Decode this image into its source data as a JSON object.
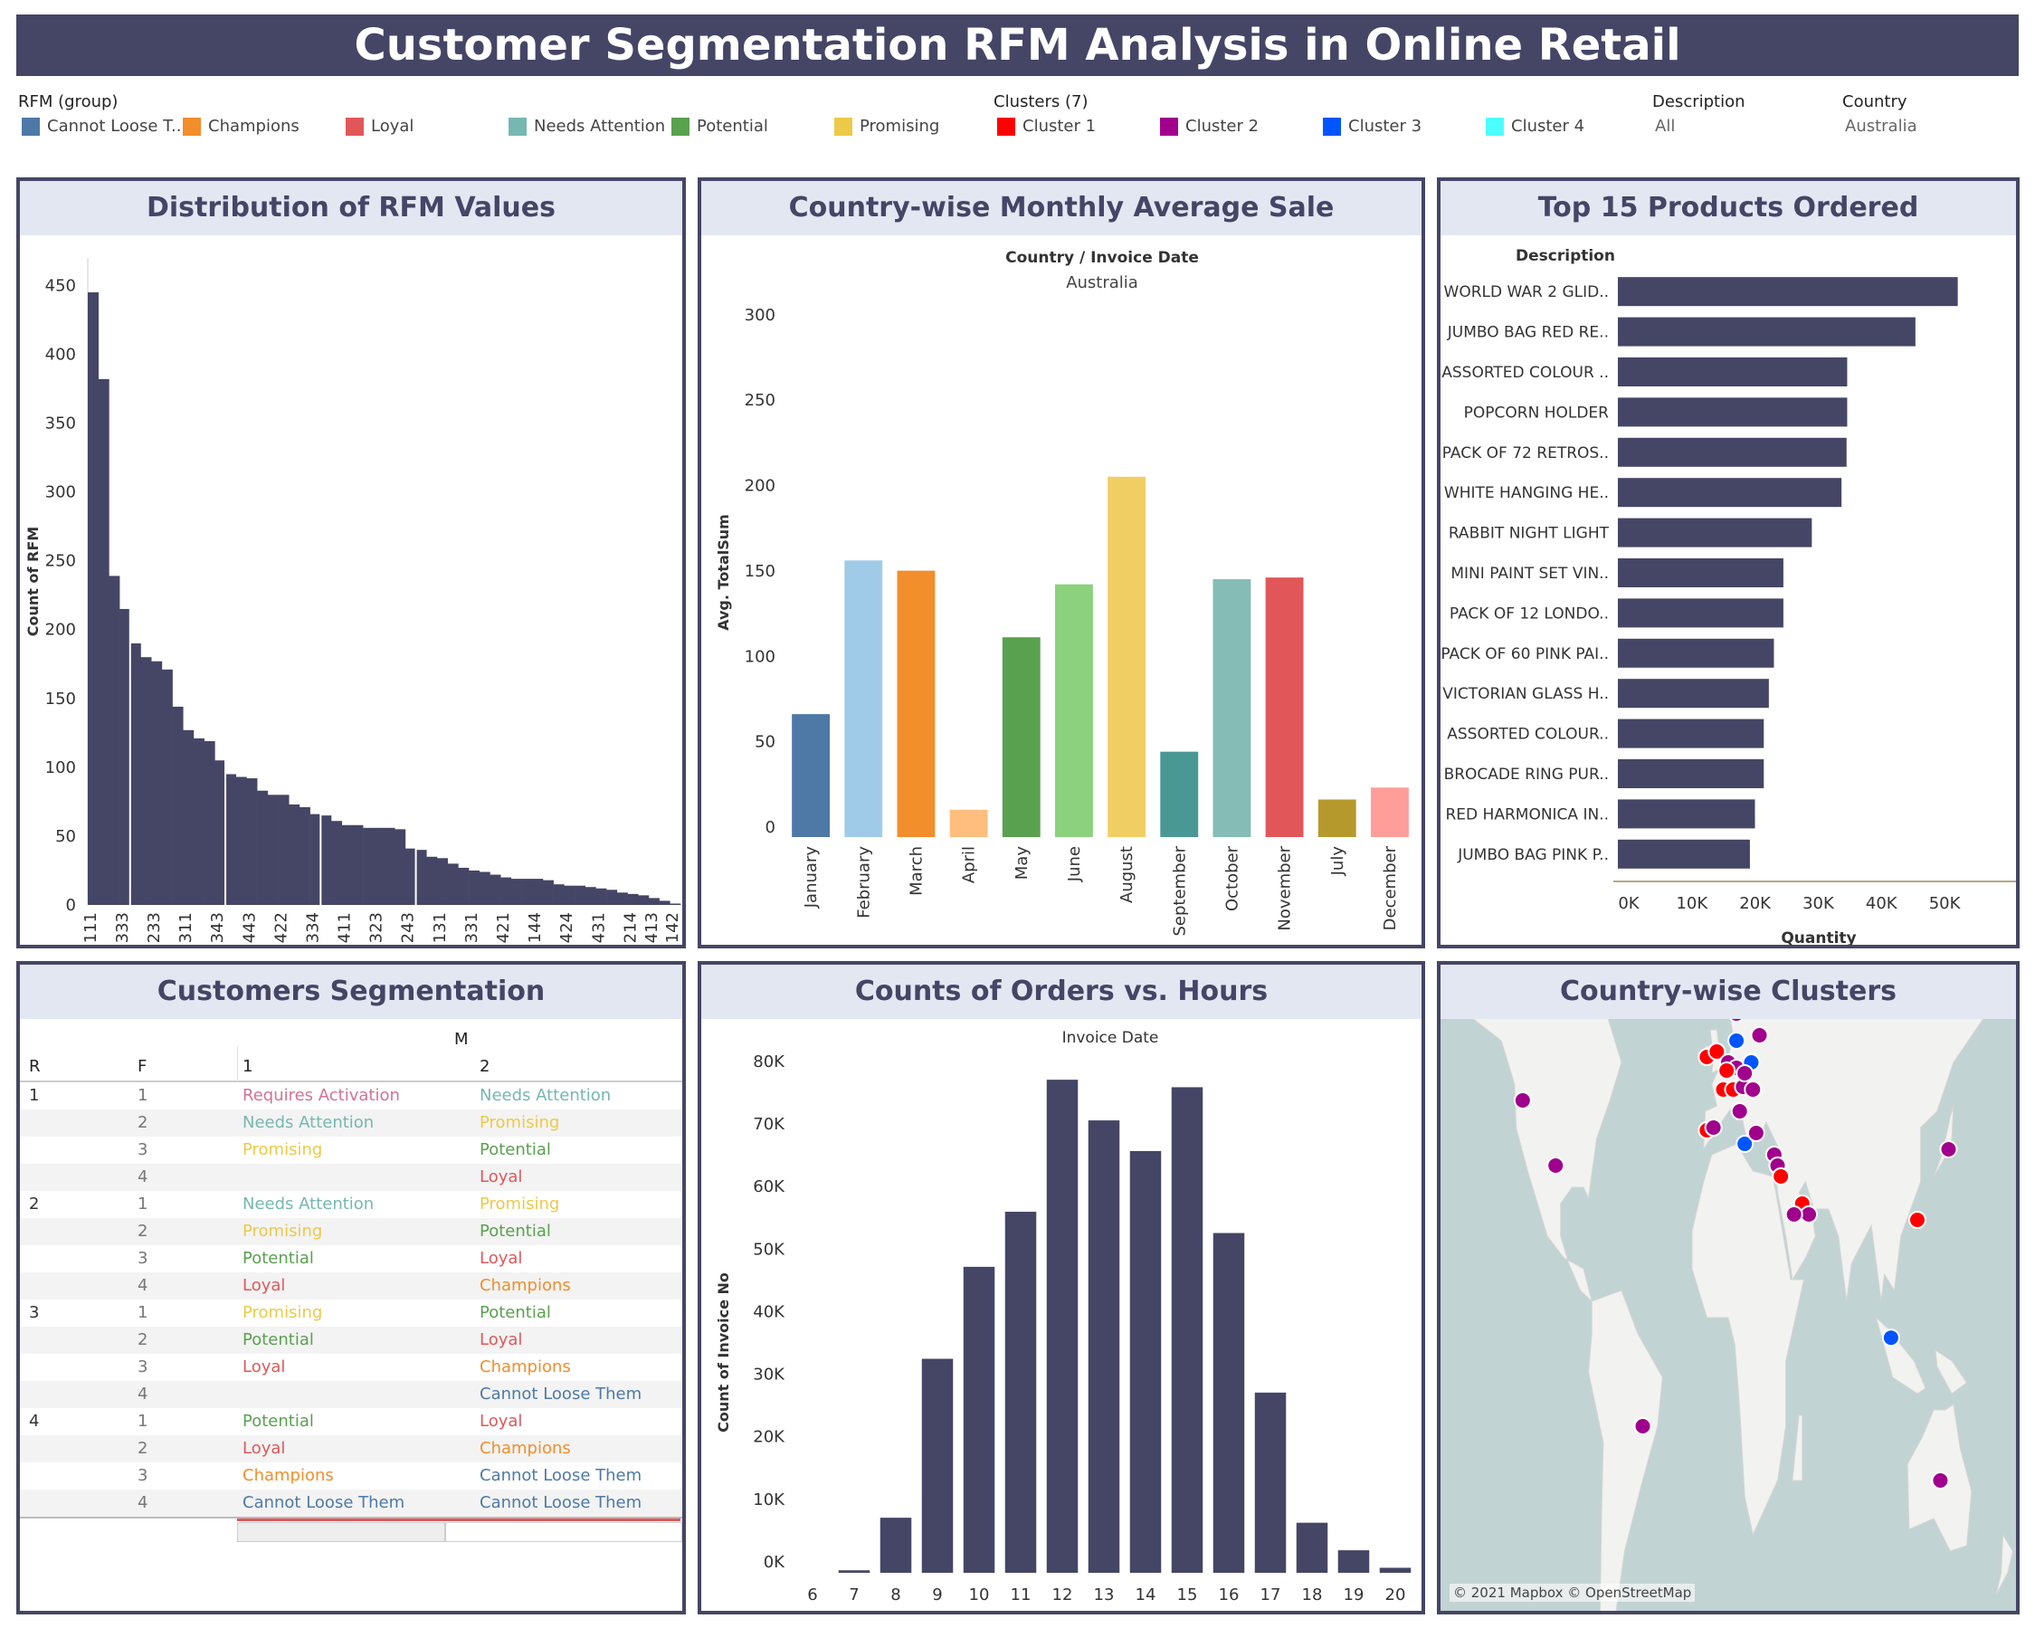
{
  "title": "Customer Segmentation RFM Analysis in Online Retail",
  "legends": {
    "rfm": {
      "title": "RFM (group)",
      "items": [
        {
          "label": "Cannot Loose T..",
          "color": "#4e79a7"
        },
        {
          "label": "Champions",
          "color": "#f28e2b"
        },
        {
          "label": "Loyal",
          "color": "#e15759"
        },
        {
          "label": "Needs Attention",
          "color": "#76b7b2"
        },
        {
          "label": "Potential",
          "color": "#59a14f"
        },
        {
          "label": "Promising",
          "color": "#edc948"
        }
      ]
    },
    "clusters": {
      "title": "Clusters (7)",
      "items": [
        {
          "label": "Cluster 1",
          "color": "#ff0000"
        },
        {
          "label": "Cluster 2",
          "color": "#a0008c"
        },
        {
          "label": "Cluster 3",
          "color": "#0055ff"
        },
        {
          "label": "Cluster 4",
          "color": "#4dffff"
        }
      ]
    },
    "description": {
      "title": "Description",
      "value": "All"
    },
    "country": {
      "title": "Country",
      "value": "Australia"
    }
  },
  "panels": {
    "rfm_dist": {
      "title": "Distribution of RFM Values"
    },
    "monthly": {
      "title": "Country-wise Monthly Average Sale",
      "subtitle": "Country / Invoice Date",
      "country": "Australia"
    },
    "products": {
      "title": "Top 15 Products Ordered"
    },
    "segmentation": {
      "title": "Customers Segmentation"
    },
    "hours": {
      "title": "Counts of Orders vs. Hours",
      "subtitle": "Invoice Date"
    },
    "clusters": {
      "title": "Country-wise Clusters",
      "attribution": "© 2021 Mapbox © OpenStreetMap"
    }
  },
  "chart_data": [
    {
      "type": "bar",
      "title": "Distribution of RFM Values",
      "ylabel": "Count of RFM",
      "ylim": [
        0,
        470
      ],
      "yticks": [
        0,
        50,
        100,
        150,
        200,
        250,
        300,
        350,
        400,
        450
      ],
      "values": [
        445,
        382,
        239,
        215,
        190,
        180,
        177,
        171,
        144,
        127,
        121,
        119,
        105,
        95,
        93,
        92,
        83,
        80,
        80,
        73,
        71,
        66,
        65,
        61,
        58,
        58,
        56,
        56,
        56,
        55,
        41,
        40,
        35,
        34,
        30,
        27,
        25,
        24,
        22,
        20,
        19,
        19,
        19,
        18,
        15,
        14,
        14,
        13,
        12,
        11,
        9,
        8,
        7,
        5,
        3,
        1
      ],
      "tick_labels": [
        "111",
        "333",
        "233",
        "311",
        "343",
        "443",
        "422",
        "334",
        "411",
        "323",
        "243",
        "131",
        "331",
        "421",
        "144",
        "424",
        "431",
        "214",
        "413",
        "142"
      ],
      "tick_indices": [
        1,
        4,
        7,
        10,
        13,
        16,
        19,
        22,
        25,
        28,
        31,
        34,
        37,
        40,
        43,
        46,
        49,
        52,
        54,
        56
      ]
    },
    {
      "type": "bar",
      "title": "Country-wise Monthly Average Sale",
      "ylabel": "Avg. TotalSum",
      "ylim": [
        0,
        310
      ],
      "yticks": [
        0,
        50,
        100,
        150,
        200,
        250,
        300
      ],
      "categories": [
        "January",
        "February",
        "March",
        "April",
        "May",
        "June",
        "August",
        "September",
        "October",
        "November",
        "July",
        "December"
      ],
      "values": [
        72,
        162,
        156,
        16,
        117,
        148,
        211,
        50,
        151,
        152,
        22,
        29
      ],
      "colors": [
        "#4e79a7",
        "#a0cbe8",
        "#f28e2b",
        "#ffbe7d",
        "#59a14f",
        "#8cd17d",
        "#f1ce63",
        "#499894",
        "#86bcb6",
        "#e15759",
        "#b6992d",
        "#ff9d9a"
      ]
    },
    {
      "type": "bar",
      "orientation": "horizontal",
      "title": "Top 15 Products Ordered",
      "ylabel": "Description",
      "xlabel": "Quantity",
      "xlim": [
        0,
        55000
      ],
      "xticks": [
        "0K",
        "10K",
        "20K",
        "30K",
        "40K",
        "50K"
      ],
      "categories": [
        "WORLD WAR 2 GLID..",
        "JUMBO BAG RED RE..",
        "ASSORTED COLOUR ..",
        "POPCORN HOLDER",
        "PACK OF 72 RETROS..",
        "WHITE HANGING HE..",
        "RABBIT NIGHT LIGHT",
        "MINI PAINT SET VIN..",
        "PACK OF 12 LONDO..",
        "PACK OF 60 PINK PAI..",
        "VICTORIAN GLASS H..",
        "ASSORTED COLOUR..",
        "BROCADE RING PUR..",
        "RED HARMONICA IN..",
        "JUMBO BAG PINK P.."
      ],
      "values": [
        53800,
        47100,
        36300,
        36300,
        36200,
        35400,
        30700,
        26200,
        26200,
        24700,
        23900,
        23100,
        23100,
        21700,
        20900
      ]
    },
    {
      "type": "bar",
      "title": "Counts of Orders vs. Hours",
      "ylabel": "Count of Invoice No",
      "ylim": [
        0,
        82000
      ],
      "yticks": [
        "0K",
        "10K",
        "20K",
        "30K",
        "40K",
        "50K",
        "60K",
        "70K",
        "80K"
      ],
      "categories": [
        "6",
        "7",
        "8",
        "9",
        "10",
        "11",
        "12",
        "13",
        "14",
        "15",
        "16",
        "17",
        "18",
        "19",
        "20"
      ],
      "values": [
        0,
        400,
        8800,
        34200,
        48900,
        57700,
        78800,
        72300,
        67400,
        77600,
        54300,
        28800,
        8000,
        3600,
        800
      ]
    }
  ],
  "segmentation": {
    "col_m": "M",
    "col_r": "R",
    "col_f": "F",
    "m_values": [
      "1",
      "2"
    ],
    "groups": [
      {
        "r": "1",
        "rows": [
          {
            "f": "1",
            "m1": "Requires Activation",
            "m1c": "#d37295",
            "m2": "Needs Attention",
            "m2c": "#76b7b2"
          },
          {
            "f": "2",
            "m1": "Needs Attention",
            "m1c": "#76b7b2",
            "m2": "Promising",
            "m2c": "#edc948"
          },
          {
            "f": "3",
            "m1": "Promising",
            "m1c": "#edc948",
            "m2": "Potential",
            "m2c": "#59a14f"
          },
          {
            "f": "4",
            "m1": "",
            "m1c": "#333",
            "m2": "Loyal",
            "m2c": "#e15759"
          }
        ]
      },
      {
        "r": "2",
        "rows": [
          {
            "f": "1",
            "m1": "Needs Attention",
            "m1c": "#76b7b2",
            "m2": "Promising",
            "m2c": "#edc948"
          },
          {
            "f": "2",
            "m1": "Promising",
            "m1c": "#edc948",
            "m2": "Potential",
            "m2c": "#59a14f"
          },
          {
            "f": "3",
            "m1": "Potential",
            "m1c": "#59a14f",
            "m2": "Loyal",
            "m2c": "#e15759"
          },
          {
            "f": "4",
            "m1": "Loyal",
            "m1c": "#e15759",
            "m2": "Champions",
            "m2c": "#f28e2b"
          }
        ]
      },
      {
        "r": "3",
        "rows": [
          {
            "f": "1",
            "m1": "Promising",
            "m1c": "#edc948",
            "m2": "Potential",
            "m2c": "#59a14f"
          },
          {
            "f": "2",
            "m1": "Potential",
            "m1c": "#59a14f",
            "m2": "Loyal",
            "m2c": "#e15759"
          },
          {
            "f": "3",
            "m1": "Loyal",
            "m1c": "#e15759",
            "m2": "Champions",
            "m2c": "#f28e2b"
          },
          {
            "f": "4",
            "m1": "",
            "m1c": "#333",
            "m2": "Cannot Loose Them",
            "m2c": "#4e79a7"
          }
        ]
      },
      {
        "r": "4",
        "rows": [
          {
            "f": "1",
            "m1": "Potential",
            "m1c": "#59a14f",
            "m2": "Loyal",
            "m2c": "#e15759"
          },
          {
            "f": "2",
            "m1": "Loyal",
            "m1c": "#e15759",
            "m2": "Champions",
            "m2c": "#f28e2b"
          },
          {
            "f": "3",
            "m1": "Champions",
            "m1c": "#f28e2b",
            "m2": "Cannot Loose Them",
            "m2c": "#4e79a7"
          },
          {
            "f": "4",
            "m1": "Cannot Loose Them",
            "m1c": "#4e79a7",
            "m2": "Cannot Loose Them",
            "m2c": "#4e79a7"
          }
        ]
      }
    ]
  },
  "map_points": [
    {
      "lon": -120,
      "lat": 45,
      "cluster": "Cluster 2"
    },
    {
      "lon": -100,
      "lat": 33,
      "cluster": "Cluster 2"
    },
    {
      "lon": -20,
      "lat": 64,
      "cluster": "Cluster 3"
    },
    {
      "lon": -47,
      "lat": -15,
      "cluster": "Cluster 2"
    },
    {
      "lon": -8,
      "lat": 53,
      "cluster": "Cluster 1"
    },
    {
      "lon": -2,
      "lat": 54,
      "cluster": "Cluster 1"
    },
    {
      "lon": 2,
      "lat": 47,
      "cluster": "Cluster 1"
    },
    {
      "lon": 5,
      "lat": 52,
      "cluster": "Cluster 2"
    },
    {
      "lon": 10,
      "lat": 51,
      "cluster": "Cluster 2"
    },
    {
      "lon": 4,
      "lat": 50.5,
      "cluster": "Cluster 1"
    },
    {
      "lon": 8,
      "lat": 47,
      "cluster": "Cluster 1"
    },
    {
      "lon": 14,
      "lat": 47.5,
      "cluster": "Cluster 2"
    },
    {
      "lon": 10,
      "lat": 56,
      "cluster": "Cluster 3"
    },
    {
      "lon": 16,
      "lat": 62,
      "cluster": "Cluster 2"
    },
    {
      "lon": 10,
      "lat": 61,
      "cluster": "Cluster 2"
    },
    {
      "lon": 26,
      "lat": 64,
      "cluster": "Cluster 2"
    },
    {
      "lon": 24,
      "lat": 57,
      "cluster": "Cluster 2"
    },
    {
      "lon": 19,
      "lat": 52,
      "cluster": "Cluster 3"
    },
    {
      "lon": 15,
      "lat": 50,
      "cluster": "Cluster 2"
    },
    {
      "lon": 20,
      "lat": 47,
      "cluster": "Cluster 2"
    },
    {
      "lon": -8,
      "lat": 39.5,
      "cluster": "Cluster 1"
    },
    {
      "lon": -4,
      "lat": 40,
      "cluster": "Cluster 2"
    },
    {
      "lon": 12,
      "lat": 43,
      "cluster": "Cluster 2"
    },
    {
      "lon": 15,
      "lat": 37,
      "cluster": "Cluster 3"
    },
    {
      "lon": 22,
      "lat": 39,
      "cluster": "Cluster 2"
    },
    {
      "lon": 33,
      "lat": 35,
      "cluster": "Cluster 2"
    },
    {
      "lon": 35,
      "lat": 33,
      "cluster": "Cluster 2"
    },
    {
      "lon": 37,
      "lat": 31,
      "cluster": "Cluster 1"
    },
    {
      "lon": 50,
      "lat": 26,
      "cluster": "Cluster 1"
    },
    {
      "lon": 54,
      "lat": 24,
      "cluster": "Cluster 2"
    },
    {
      "lon": 45,
      "lat": 24,
      "cluster": "Cluster 2"
    },
    {
      "lon": 120,
      "lat": 23,
      "cluster": "Cluster 1"
    },
    {
      "lon": 139,
      "lat": 36,
      "cluster": "Cluster 2"
    },
    {
      "lon": 104,
      "lat": 1.3,
      "cluster": "Cluster 3"
    },
    {
      "lon": 134,
      "lat": -25,
      "cluster": "Cluster 2"
    }
  ]
}
